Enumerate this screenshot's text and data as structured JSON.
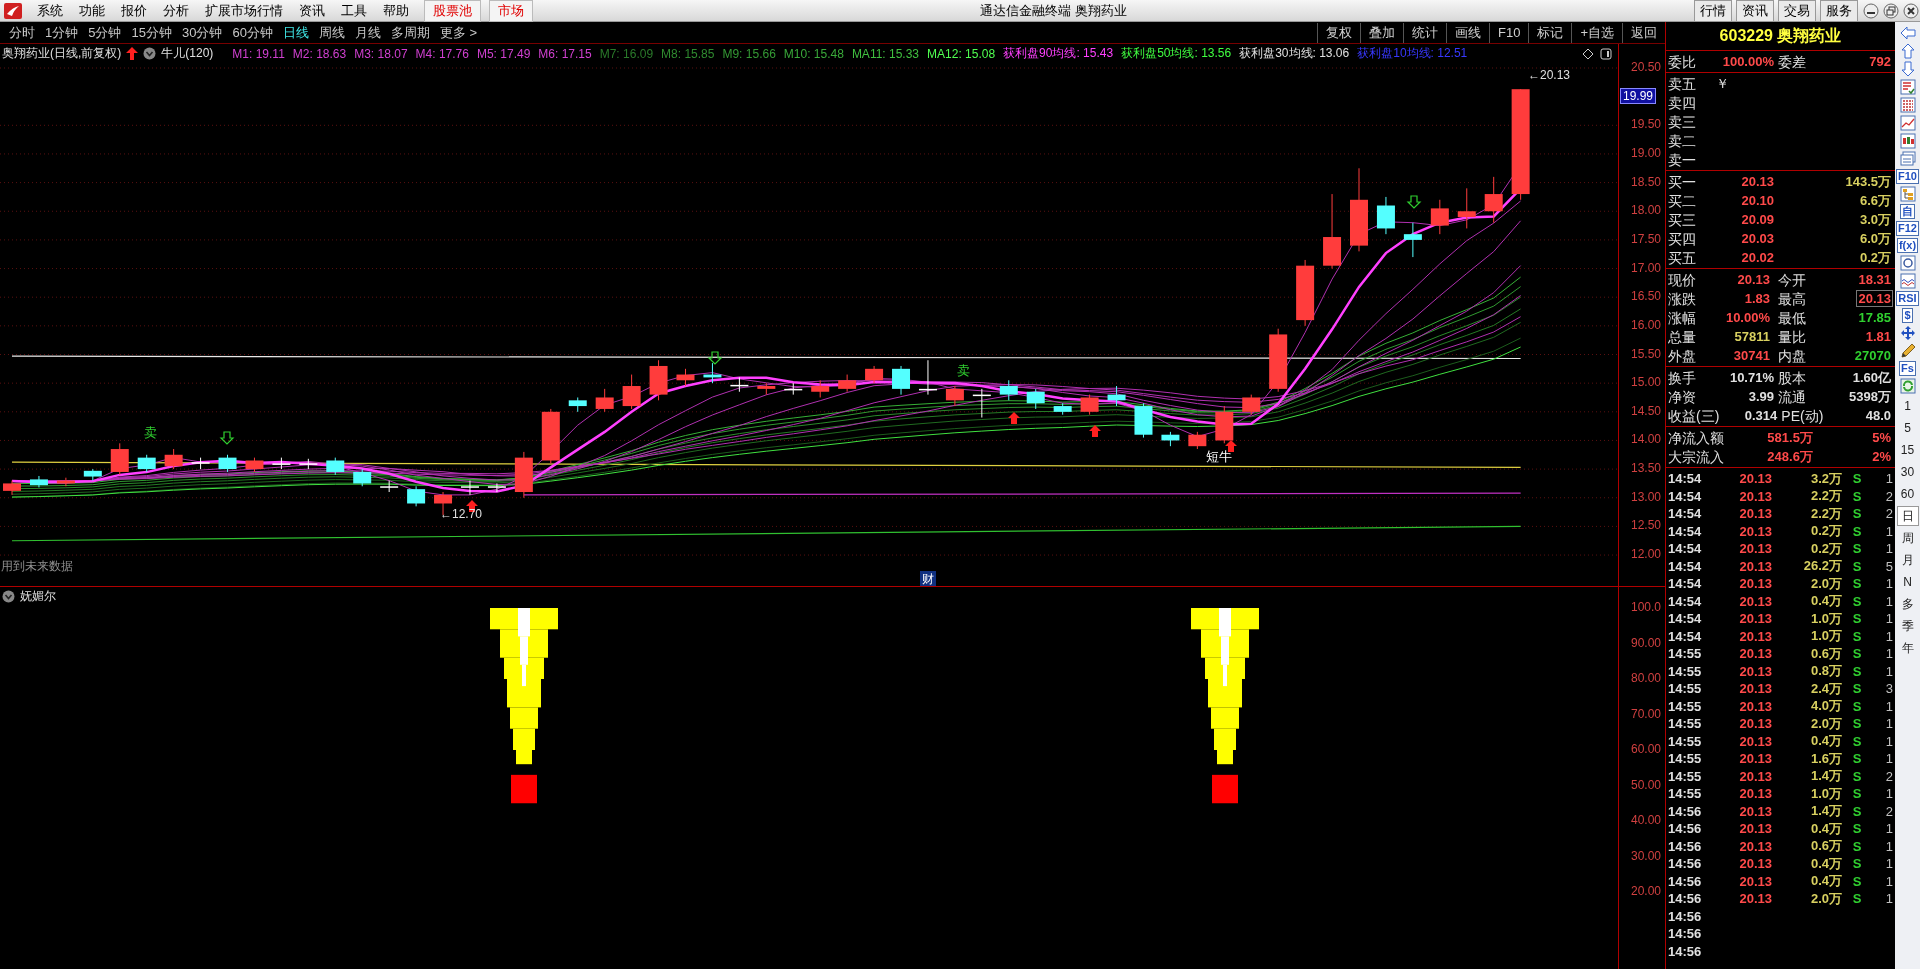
{
  "menubar": {
    "menus": [
      "系统",
      "功能",
      "报价",
      "分析",
      "扩展市场行情",
      "资讯",
      "工具",
      "帮助"
    ],
    "highlight_buttons": [
      "股票池",
      "市场"
    ],
    "title": "通达信金融终端 奥翔药业",
    "service_buttons": [
      "行情",
      "资讯",
      "交易",
      "服务"
    ]
  },
  "period_tabs": [
    {
      "label": "分时",
      "selected": false
    },
    {
      "label": "1分钟",
      "selected": false
    },
    {
      "label": "5分钟",
      "selected": false
    },
    {
      "label": "15分钟",
      "selected": false
    },
    {
      "label": "30分钟",
      "selected": false
    },
    {
      "label": "60分钟",
      "selected": false
    },
    {
      "label": "日线",
      "selected": true
    },
    {
      "label": "周线",
      "selected": false
    },
    {
      "label": "月线",
      "selected": false
    },
    {
      "label": "多周期",
      "selected": false
    },
    {
      "label": "更多 >",
      "selected": false
    }
  ],
  "chart_tools": [
    "复权",
    "叠加",
    "统计",
    "画线",
    "F10",
    "标记",
    "+自选",
    "返回"
  ],
  "main_chart": {
    "title": "奥翔药业(日线,前复权)",
    "indicator": "牛儿(120)",
    "legend": [
      {
        "label": "M1: 19.11",
        "color": "#d040d0"
      },
      {
        "label": "M2: 18.63",
        "color": "#d040d0"
      },
      {
        "label": "M3: 18.07",
        "color": "#d040d0"
      },
      {
        "label": "M4: 17.76",
        "color": "#d040d0"
      },
      {
        "label": "M5: 17.49",
        "color": "#d040d0"
      },
      {
        "label": "M6: 17.15",
        "color": "#d040d0"
      },
      {
        "label": "M7: 16.09",
        "color": "#2a7a2a"
      },
      {
        "label": "M8: 15.85",
        "color": "#2f8a2f"
      },
      {
        "label": "M9: 15.66",
        "color": "#349a34"
      },
      {
        "label": "M10: 15.48",
        "color": "#3aaa3a"
      },
      {
        "label": "MA11: 15.33",
        "color": "#40c040"
      },
      {
        "label": "MA12: 15.08",
        "color": "#50ff50"
      },
      {
        "label": "获利盘90均线: 15.43",
        "color": "#ff40ff"
      },
      {
        "label": "获利盘50均线: 13.56",
        "color": "#40ff40"
      },
      {
        "label": "获利盘30均线: 13.06",
        "color": "#e0e0e0"
      },
      {
        "label": "获利盘10均线: 12.51",
        "color": "#3838ff"
      }
    ],
    "y_axis": [
      "20.50",
      "19.50",
      "19.00",
      "18.50",
      "18.00",
      "17.50",
      "17.00",
      "16.50",
      "16.00",
      "15.50",
      "15.00",
      "14.50",
      "14.00",
      "13.50",
      "13.00",
      "12.50",
      "12.00"
    ],
    "price_tag": "19.99",
    "high_label": "←20.13",
    "low_label": "←12.70",
    "signals": [
      {
        "kind": "sell",
        "text": "卖"
      },
      {
        "kind": "sell",
        "text": "卖"
      },
      {
        "kind": "bull",
        "text": "短牛"
      }
    ],
    "note": "用到未来数据",
    "finance_marker": "财"
  },
  "sub_chart": {
    "title": "妩媚尔",
    "y_axis": [
      "100.0",
      "90.00",
      "80.00",
      "70.00",
      "60.00",
      "50.00",
      "40.00",
      "30.00",
      "20.00"
    ]
  },
  "quote": {
    "code_name": "603229 奥翔药业",
    "ratio": {
      "label": "委比",
      "value": "100.00%",
      "diff_label": "委差",
      "diff": "792"
    },
    "asks": [
      "卖五",
      "卖四",
      "卖三",
      "卖二",
      "卖一"
    ],
    "ask_mark": "￥",
    "bids": [
      {
        "label": "买一",
        "price": "20.13",
        "volume": "143.5万"
      },
      {
        "label": "买二",
        "price": "20.10",
        "volume": "6.6万"
      },
      {
        "label": "买三",
        "price": "20.09",
        "volume": "3.0万"
      },
      {
        "label": "买四",
        "price": "20.03",
        "volume": "6.0万"
      },
      {
        "label": "买五",
        "price": "20.02",
        "volume": "0.2万"
      }
    ],
    "stats": [
      {
        "label": "现价",
        "value": "20.13",
        "color": "#ff4a4a",
        "highlighted": false
      },
      {
        "label": "今开",
        "value": "18.31",
        "color": "#ff4a4a",
        "highlighted": false
      },
      {
        "label": "涨跌",
        "value": "1.83",
        "color": "#ff4a4a",
        "highlighted": false
      },
      {
        "label": "最高",
        "value": "20.13",
        "color": "#ff4a4a",
        "highlighted": true
      },
      {
        "label": "涨幅",
        "value": "10.00%",
        "color": "#ff4a4a",
        "highlighted": false
      },
      {
        "label": "最低",
        "value": "17.85",
        "color": "#30d030",
        "highlighted": false
      },
      {
        "label": "总量",
        "value": "57811",
        "color": "#d8d060",
        "highlighted": false
      },
      {
        "label": "量比",
        "value": "1.81",
        "color": "#ff4a4a",
        "highlighted": false
      },
      {
        "label": "外盘",
        "value": "30741",
        "color": "#ff4a4a",
        "highlighted": false
      },
      {
        "label": "内盘",
        "value": "27070",
        "color": "#30d030",
        "highlighted": false
      }
    ],
    "fundamentals": [
      {
        "label": "换手",
        "value": "10.71%",
        "label2": "股本",
        "value2": "1.60亿"
      },
      {
        "label": "净资",
        "value": "3.99",
        "label2": "流通",
        "value2": "5398万"
      },
      {
        "label": "收益(三)",
        "value": "0.314",
        "label2": "PE(动)",
        "value2": "48.0"
      }
    ],
    "flows": [
      {
        "label": "净流入额",
        "value": "581.5万",
        "share": "5%"
      },
      {
        "label": "大宗流入",
        "value": "248.6万",
        "share": "2%"
      }
    ],
    "ticks": [
      {
        "time": "14:54",
        "price": "20.13",
        "volume": "3.2万",
        "side": "S",
        "count": "1"
      },
      {
        "time": "14:54",
        "price": "20.13",
        "volume": "2.2万",
        "side": "S",
        "count": "2"
      },
      {
        "time": "14:54",
        "price": "20.13",
        "volume": "2.2万",
        "side": "S",
        "count": "2"
      },
      {
        "time": "14:54",
        "price": "20.13",
        "volume": "0.2万",
        "side": "S",
        "count": "1"
      },
      {
        "time": "14:54",
        "price": "20.13",
        "volume": "0.2万",
        "side": "S",
        "count": "1"
      },
      {
        "time": "14:54",
        "price": "20.13",
        "volume": "26.2万",
        "side": "S",
        "count": "5"
      },
      {
        "time": "14:54",
        "price": "20.13",
        "volume": "2.0万",
        "side": "S",
        "count": "1"
      },
      {
        "time": "14:54",
        "price": "20.13",
        "volume": "0.4万",
        "side": "S",
        "count": "1"
      },
      {
        "time": "14:54",
        "price": "20.13",
        "volume": "1.0万",
        "side": "S",
        "count": "1"
      },
      {
        "time": "14:54",
        "price": "20.13",
        "volume": "1.0万",
        "side": "S",
        "count": "1"
      },
      {
        "time": "14:55",
        "price": "20.13",
        "volume": "0.6万",
        "side": "S",
        "count": "1"
      },
      {
        "time": "14:55",
        "price": "20.13",
        "volume": "0.8万",
        "side": "S",
        "count": "1"
      },
      {
        "time": "14:55",
        "price": "20.13",
        "volume": "2.4万",
        "side": "S",
        "count": "3"
      },
      {
        "time": "14:55",
        "price": "20.13",
        "volume": "4.0万",
        "side": "S",
        "count": "1"
      },
      {
        "time": "14:55",
        "price": "20.13",
        "volume": "2.0万",
        "side": "S",
        "count": "1"
      },
      {
        "time": "14:55",
        "price": "20.13",
        "volume": "0.4万",
        "side": "S",
        "count": "1"
      },
      {
        "time": "14:55",
        "price": "20.13",
        "volume": "1.6万",
        "side": "S",
        "count": "1"
      },
      {
        "time": "14:55",
        "price": "20.13",
        "volume": "1.4万",
        "side": "S",
        "count": "2"
      },
      {
        "time": "14:55",
        "price": "20.13",
        "volume": "1.0万",
        "side": "S",
        "count": "1"
      },
      {
        "time": "14:56",
        "price": "20.13",
        "volume": "1.4万",
        "side": "S",
        "count": "2"
      },
      {
        "time": "14:56",
        "price": "20.13",
        "volume": "0.4万",
        "side": "S",
        "count": "1"
      },
      {
        "time": "14:56",
        "price": "20.13",
        "volume": "0.6万",
        "side": "S",
        "count": "1"
      },
      {
        "time": "14:56",
        "price": "20.13",
        "volume": "0.4万",
        "side": "S",
        "count": "1"
      },
      {
        "time": "14:56",
        "price": "20.13",
        "volume": "0.4万",
        "side": "S",
        "count": "1"
      },
      {
        "time": "14:56",
        "price": "20.13",
        "volume": "2.0万",
        "side": "S",
        "count": "1"
      },
      {
        "time": "14:56"
      },
      {
        "time": "14:56"
      },
      {
        "time": "14:56"
      }
    ]
  },
  "side_strip": {
    "tools": [
      {
        "kind": "arrow-left"
      },
      {
        "kind": "arrow-up"
      },
      {
        "kind": "arrow-down"
      },
      {
        "kind": "list-check"
      },
      {
        "kind": "grid"
      },
      {
        "kind": "line-chart"
      },
      {
        "kind": "candles"
      },
      {
        "kind": "window-list"
      },
      {
        "kind": "text",
        "label": "F10"
      },
      {
        "kind": "tree"
      },
      {
        "kind": "text",
        "label": "自"
      },
      {
        "kind": "text",
        "label": "F12"
      },
      {
        "kind": "text",
        "label": "f(x)"
      },
      {
        "kind": "circle"
      },
      {
        "kind": "wave"
      },
      {
        "kind": "text",
        "label": "RSI"
      },
      {
        "kind": "text",
        "label": "$"
      },
      {
        "kind": "move"
      },
      {
        "kind": "pencil"
      },
      {
        "kind": "text",
        "label": "Fs"
      },
      {
        "kind": "refresh"
      }
    ],
    "periods": [
      {
        "label": "1",
        "selected": false
      },
      {
        "label": "5",
        "selected": false
      },
      {
        "label": "15",
        "selected": false
      },
      {
        "label": "30",
        "selected": false
      },
      {
        "label": "60",
        "selected": false
      },
      {
        "label": "日",
        "selected": true
      },
      {
        "label": "周",
        "selected": false
      },
      {
        "label": "月",
        "selected": false
      },
      {
        "label": "N",
        "selected": false
      },
      {
        "label": "多",
        "selected": false
      },
      {
        "label": "季",
        "selected": false
      },
      {
        "label": "年",
        "selected": false
      }
    ]
  }
}
